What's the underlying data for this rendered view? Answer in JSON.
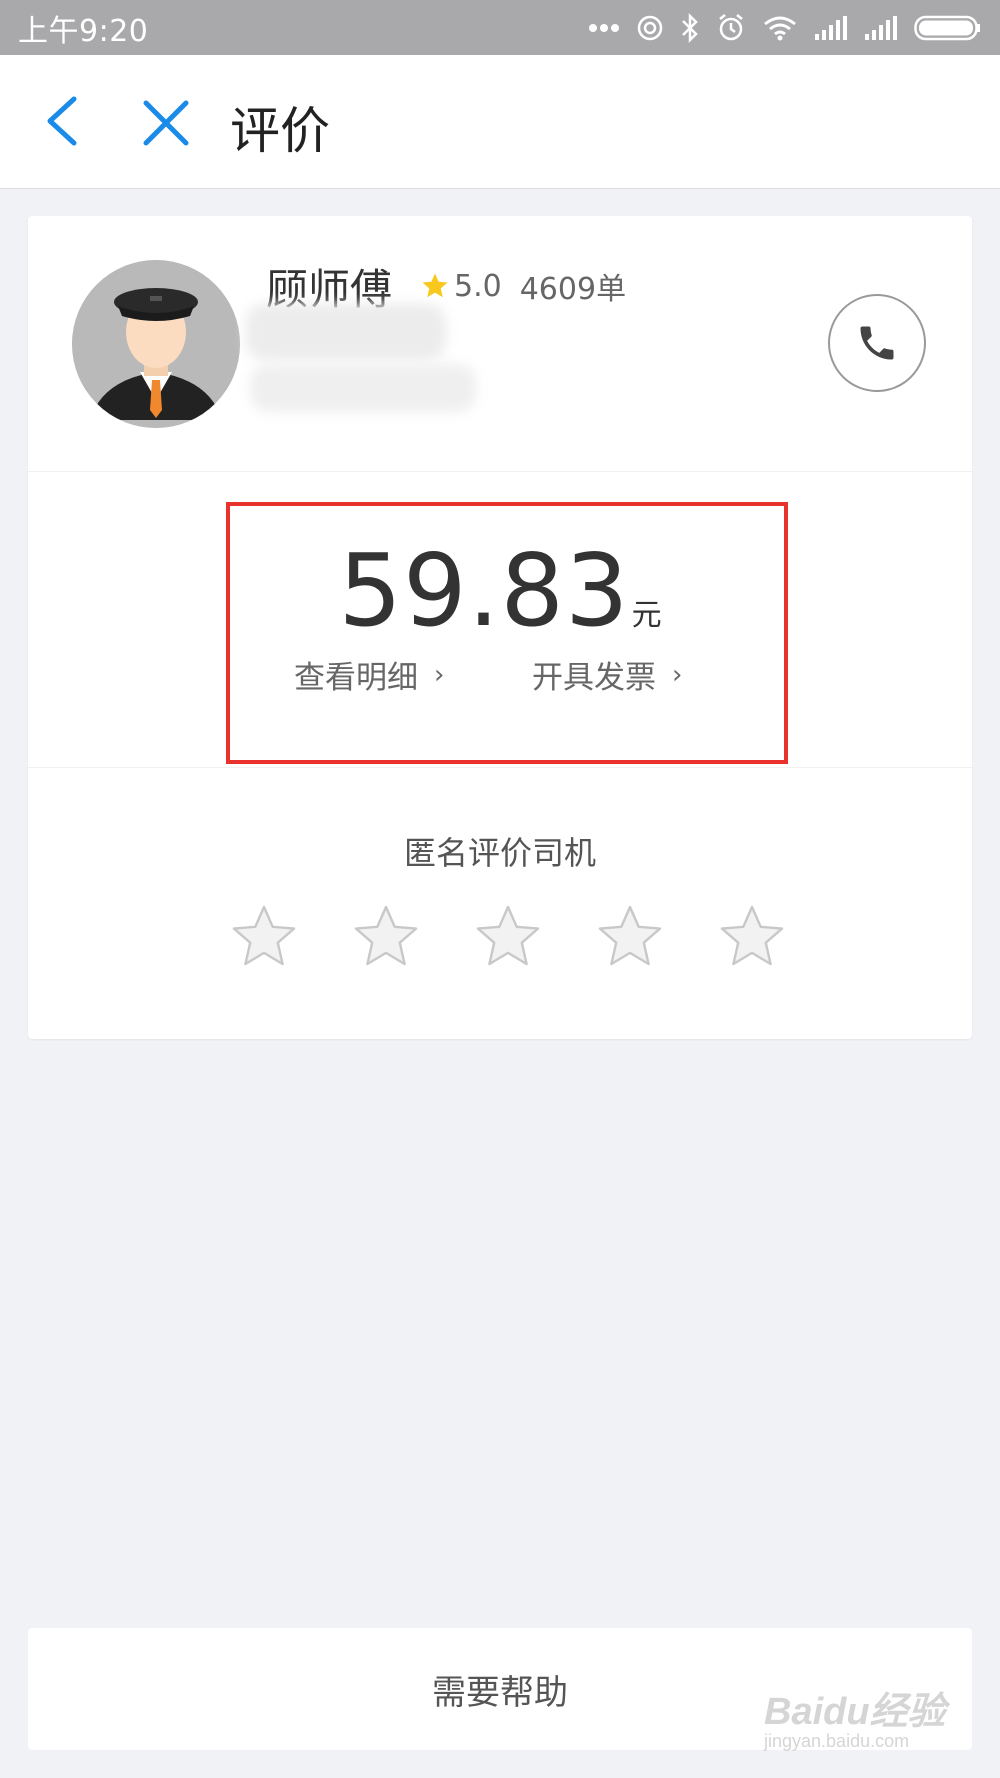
{
  "status_bar": {
    "time": "上午9:20",
    "icons": [
      "more-dots-icon",
      "hotspot-icon",
      "bluetooth-icon",
      "alarm-icon",
      "wifi-icon",
      "signal-icon",
      "signal-icon",
      "battery-icon"
    ]
  },
  "header": {
    "title": "评价",
    "back_icon": "chevron-left-icon",
    "close_icon": "close-icon"
  },
  "driver": {
    "name": "顾师傅",
    "rating": "5.0",
    "orders": "4609单",
    "avatar": "driver-avatar",
    "phone_icon": "phone-icon"
  },
  "fare": {
    "amount": "59.83",
    "unit": "元",
    "detail_link": "查看明细",
    "invoice_link": "开具发票",
    "chevron": "›"
  },
  "review": {
    "label": "匿名评价司机",
    "stars_total": 5,
    "stars_selected": 0
  },
  "help_button": "需要帮助",
  "watermark": {
    "main": "Baidu经验",
    "sub": "jingyan.baidu.com"
  },
  "colors": {
    "accent_blue": "#1a8be8",
    "highlight_red": "#e8322b",
    "rating_star": "#f8c81c"
  }
}
